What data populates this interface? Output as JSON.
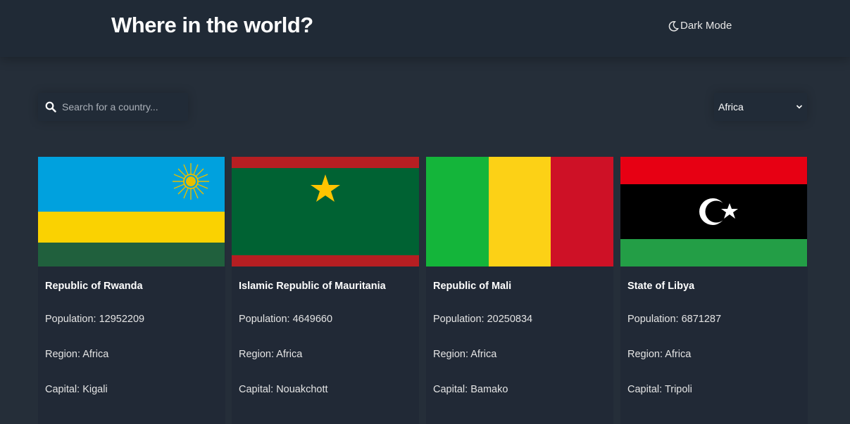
{
  "header": {
    "title": "Where in the world?",
    "mode_label": "Dark Mode",
    "mode_icon": "moon-icon"
  },
  "search": {
    "placeholder": "Search for a country...",
    "value": "",
    "icon": "search-icon"
  },
  "filter": {
    "selected": "Africa"
  },
  "labels": {
    "population": "Population: ",
    "region": "Region: ",
    "capital": "Capital: "
  },
  "countries": [
    {
      "name": "Republic of Rwanda",
      "population": "12952209",
      "region": "Africa",
      "capital": "Kigali",
      "flag": "rwanda"
    },
    {
      "name": "Islamic Republic of Mauritania",
      "population": "4649660",
      "region": "Africa",
      "capital": "Nouakchott",
      "flag": "mauritania"
    },
    {
      "name": "Republic of Mali",
      "population": "20250834",
      "region": "Africa",
      "capital": "Bamako",
      "flag": "mali"
    },
    {
      "name": "State of Libya",
      "population": "6871287",
      "region": "Africa",
      "capital": "Tripoli",
      "flag": "libya"
    }
  ]
}
